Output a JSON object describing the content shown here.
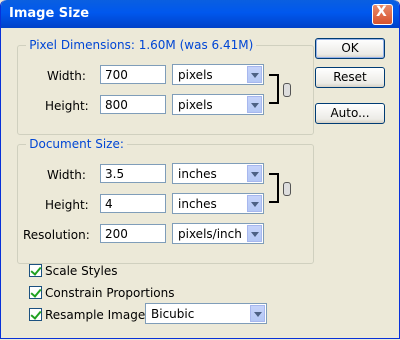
{
  "window": {
    "title": "Image Size",
    "close_label": "X"
  },
  "pixel_dimensions": {
    "legend": "Pixel Dimensions:  1.60M (was 6.41M)",
    "width_label": "Width:",
    "width_value": "700",
    "width_unit": "pixels",
    "height_label": "Height:",
    "height_value": "800",
    "height_unit": "pixels"
  },
  "document_size": {
    "legend": "Document Size:",
    "width_label": "Width:",
    "width_value": "3.5",
    "width_unit": "inches",
    "height_label": "Height:",
    "height_value": "4",
    "height_unit": "inches",
    "resolution_label": "Resolution:",
    "resolution_value": "200",
    "resolution_unit": "pixels/inch"
  },
  "options": {
    "scale_styles": {
      "label": "Scale Styles",
      "checked": true
    },
    "constrain_proportions": {
      "label": "Constrain Proportions",
      "checked": true
    },
    "resample_image": {
      "label": "Resample Image:",
      "checked": true,
      "method": "Bicubic"
    }
  },
  "buttons": {
    "ok": "OK",
    "reset": "Reset",
    "auto": "Auto..."
  }
}
